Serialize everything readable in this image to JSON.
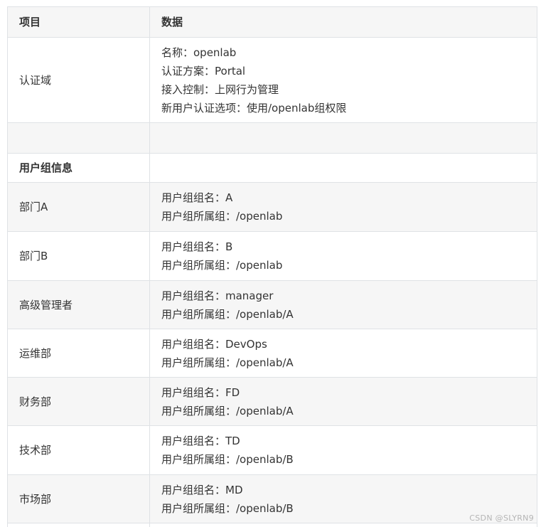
{
  "table": {
    "headers": [
      "项目",
      "数据"
    ],
    "rows": [
      {
        "label": "认证域",
        "lines": [
          "名称：openlab",
          "认证方案：Portal",
          "接入控制：上网行为管理",
          "新用户认证选项：使用/openlab组权限"
        ]
      },
      {
        "label": "",
        "lines": []
      },
      {
        "label": "用户组信息",
        "lines": [],
        "bold": true
      },
      {
        "label": "部门A",
        "lines": [
          "用户组组名：A",
          "用户组所属组：/openlab"
        ]
      },
      {
        "label": "部门B",
        "lines": [
          "用户组组名：B",
          "用户组所属组：/openlab"
        ]
      },
      {
        "label": "高级管理者",
        "lines": [
          "用户组组名：manager",
          "用户组所属组：/openlab/A"
        ]
      },
      {
        "label": "运维部",
        "lines": [
          "用户组组名：DevOps",
          "用户组所属组：/openlab/A"
        ]
      },
      {
        "label": "财务部",
        "lines": [
          "用户组组名：FD",
          "用户组所属组：/openlab/A"
        ]
      },
      {
        "label": "技术部",
        "lines": [
          "用户组组名：TD",
          "用户组所属组：/openlab/B"
        ]
      },
      {
        "label": "市场部",
        "lines": [
          "用户组组名：MD",
          "用户组所属组：/openlab/B"
        ]
      },
      {
        "label": "",
        "lines": []
      }
    ]
  },
  "watermark": "CSDN @SLYRN9"
}
